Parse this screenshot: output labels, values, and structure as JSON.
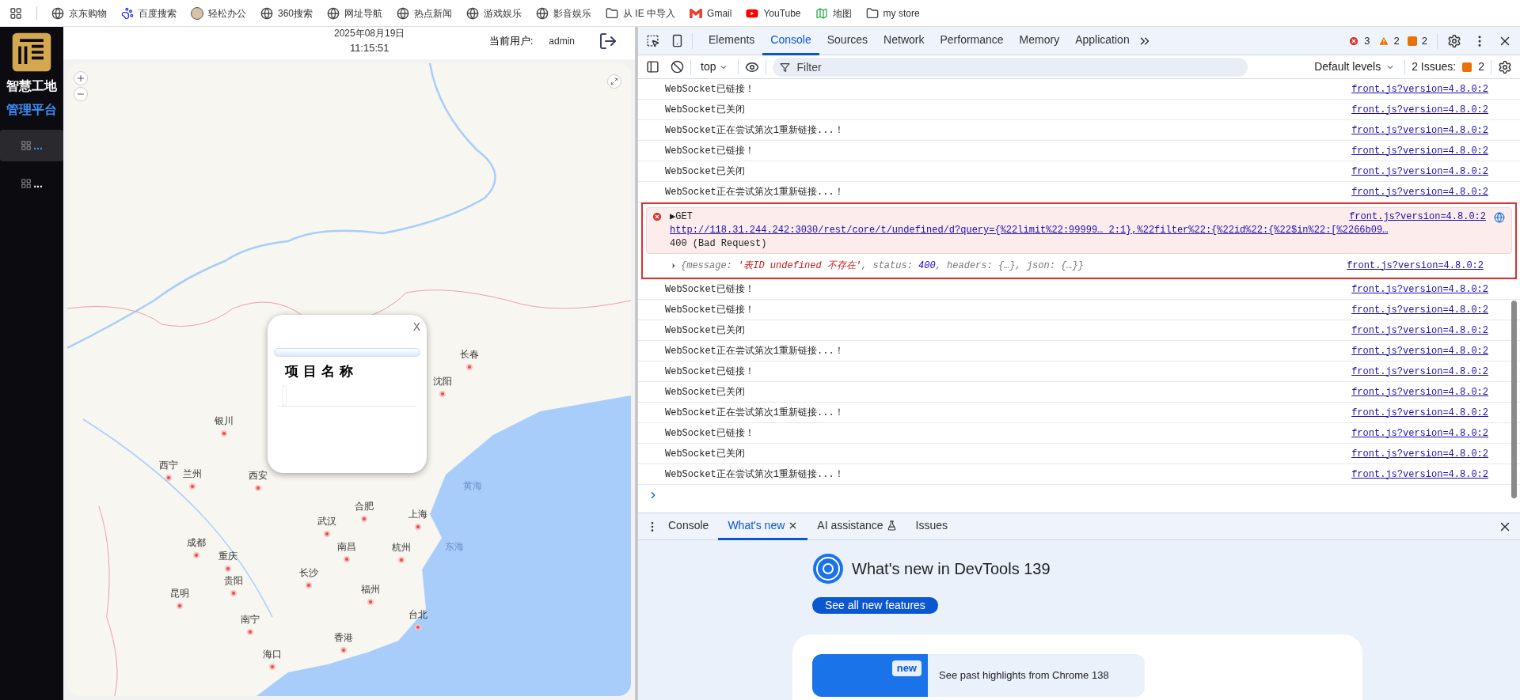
{
  "bookmarks": [
    {
      "label": "京东购物"
    },
    {
      "label": "百度搜索"
    },
    {
      "label": "轻松办公"
    },
    {
      "label": "360搜索"
    },
    {
      "label": "网址导航"
    },
    {
      "label": "热点新闻"
    },
    {
      "label": "游戏娱乐"
    },
    {
      "label": "影音娱乐"
    },
    {
      "label": "从 IE 中导入"
    },
    {
      "label": "Gmail"
    },
    {
      "label": "YouTube"
    },
    {
      "label": "地图"
    },
    {
      "label": "my store"
    }
  ],
  "app": {
    "logo_lines": [
      "智慧工地",
      "管理平台"
    ],
    "date": "2025年08月19日",
    "time": "11:15:51",
    "user_label": "当前用户:",
    "user": "admin",
    "nav": [
      {
        "label": "...",
        "selected": true
      },
      {
        "label": "...",
        "selected": false
      }
    ],
    "map": {
      "places": [
        {
          "name": "长春",
          "kind": "city"
        },
        {
          "name": "沈阳",
          "kind": "city"
        },
        {
          "name": "银川",
          "kind": "city"
        },
        {
          "name": "西宁",
          "kind": "city"
        },
        {
          "name": "兰州",
          "kind": "city"
        },
        {
          "name": "西安",
          "kind": "city"
        },
        {
          "name": "合肥",
          "kind": "city"
        },
        {
          "name": "上海",
          "kind": "city"
        },
        {
          "name": "武汉",
          "kind": "city"
        },
        {
          "name": "南昌",
          "kind": "city"
        },
        {
          "name": "杭州",
          "kind": "city"
        },
        {
          "name": "成都",
          "kind": "city"
        },
        {
          "name": "重庆",
          "kind": "city"
        },
        {
          "name": "贵阳",
          "kind": "city"
        },
        {
          "name": "长沙",
          "kind": "city"
        },
        {
          "name": "福州",
          "kind": "city"
        },
        {
          "name": "昆明",
          "kind": "city"
        },
        {
          "name": "台北",
          "kind": "city"
        },
        {
          "name": "南宁",
          "kind": "city"
        },
        {
          "name": "香港",
          "kind": "city"
        },
        {
          "name": "海口",
          "kind": "city"
        },
        {
          "name": "黄海",
          "kind": "sea"
        },
        {
          "name": "东海",
          "kind": "sea"
        }
      ]
    },
    "popup": {
      "close": "X",
      "title": "项目名称"
    }
  },
  "devtools": {
    "tabs": [
      {
        "label": "Elements",
        "selected": false
      },
      {
        "label": "Console",
        "selected": true
      },
      {
        "label": "Sources",
        "selected": false
      },
      {
        "label": "Network",
        "selected": false
      },
      {
        "label": "Performance",
        "selected": false
      },
      {
        "label": "Memory",
        "selected": false
      },
      {
        "label": "Application",
        "selected": false
      }
    ],
    "errors": "3",
    "warnings": "2",
    "issues": "2",
    "context": "top",
    "filter_placeholder": "Filter",
    "levels": "Default levels",
    "issues_label": "2 Issues:",
    "issues_count": "2",
    "messages": [
      {
        "kind": "log",
        "text": "WebSocket已链接！",
        "source": "front.js?version=4.8.0:2"
      },
      {
        "kind": "log",
        "text": "WebSocket已关闭",
        "source": "front.js?version=4.8.0:2"
      },
      {
        "kind": "log",
        "text": "WebSocket正在尝试第次1重新链接...！",
        "source": "front.js?version=4.8.0:2"
      },
      {
        "kind": "log",
        "text": "WebSocket已链接！",
        "source": "front.js?version=4.8.0:2"
      },
      {
        "kind": "log",
        "text": "WebSocket已关闭",
        "source": "front.js?version=4.8.0:2"
      },
      {
        "kind": "log",
        "text": "WebSocket正在尝试第次1重新链接...！",
        "source": "front.js?version=4.8.0:2"
      },
      {
        "kind": "error",
        "marker": "▶",
        "method": "GET",
        "url": "http://118.31.244.242:3030/rest/core/t/undefined/d?query={%22limit%22:99999… 2:1},%22filter%22:{%22id%22:{%22$in%22:[%2266b09…",
        "status": "400 (Bad Request)",
        "source": "front.js?version=4.8.0:2"
      },
      {
        "kind": "object",
        "parts": [
          {
            "text": "{message: ",
            "kind": "key"
          },
          {
            "text": "'表ID undefined 不存在'",
            "kind": "string"
          },
          {
            "text": ", status: ",
            "kind": "key"
          },
          {
            "text": "400",
            "kind": "number"
          },
          {
            "text": ", headers: {…}, json: {…}}",
            "kind": "key"
          }
        ],
        "source": "front.js?version=4.8.0:2"
      },
      {
        "kind": "log",
        "text": "WebSocket已链接！",
        "source": "front.js?version=4.8.0:2"
      },
      {
        "kind": "log",
        "text": "WebSocket已链接！",
        "source": "front.js?version=4.8.0:2"
      },
      {
        "kind": "log",
        "text": "WebSocket已关闭",
        "source": "front.js?version=4.8.0:2"
      },
      {
        "kind": "log",
        "text": "WebSocket正在尝试第次1重新链接...！",
        "source": "front.js?version=4.8.0:2"
      },
      {
        "kind": "log",
        "text": "WebSocket已链接！",
        "source": "front.js?version=4.8.0:2"
      },
      {
        "kind": "log",
        "text": "WebSocket已关闭",
        "source": "front.js?version=4.8.0:2"
      },
      {
        "kind": "log",
        "text": "WebSocket正在尝试第次1重新链接...！",
        "source": "front.js?version=4.8.0:2"
      },
      {
        "kind": "log",
        "text": "WebSocket已链接！",
        "source": "front.js?version=4.8.0:2"
      },
      {
        "kind": "log",
        "text": "WebSocket已关闭",
        "source": "front.js?version=4.8.0:2"
      },
      {
        "kind": "log",
        "text": "WebSocket正在尝试第次1重新链接...！",
        "source": "front.js?version=4.8.0:2"
      }
    ],
    "drawer_tabs": [
      {
        "label": "Console",
        "selected": false
      },
      {
        "label": "What's new",
        "selected": true
      },
      {
        "label": "AI assistance",
        "selected": false
      },
      {
        "label": "Issues",
        "selected": false
      }
    ],
    "whats_new": {
      "title": "What's new in DevTools 139",
      "button": "See all new features",
      "badge": "new",
      "highlight": "See past highlights from Chrome 138"
    }
  }
}
